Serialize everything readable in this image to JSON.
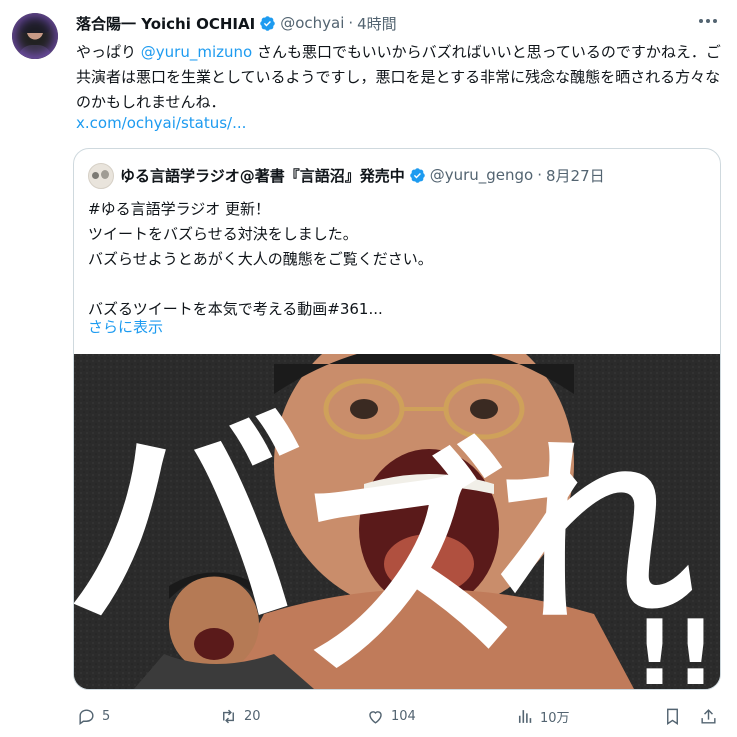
{
  "author": {
    "name": "落合陽一 Yoichi OCHIAI",
    "handle": "@ochyai",
    "separator": "·",
    "time": "4時間"
  },
  "tweet": {
    "text_before": "やっぱり ",
    "mention": "@yuru_mizuno",
    "text_after": " さんも悪口でもいいからバズればいいと思っているのですかねえ．ご共演者は悪口を生業としているようですし，悪口を是とする非常に残念な醜態を晒される方々なのかもしれませんね．",
    "link": "x.com/ochyai/status/..."
  },
  "quote": {
    "name": "ゆる言語学ラジオ@著書『言語沼』発売中",
    "handle": "@yuru_gengo",
    "separator": "·",
    "date": "8月27日",
    "text": "#ゆる言語学ラジオ 更新！\nツイートをバズらせる対決をしました。\nバズらせようとあがく大人の醜態をご覧ください。\n\nバズるツイートを本気で考える動画#361...",
    "show_more": "さらに表示",
    "media_text_1": "バ",
    "media_text_2": "ズ",
    "media_text_3": "れ",
    "media_text_4": "!!"
  },
  "actions": {
    "replies": "5",
    "retweets": "20",
    "likes": "104",
    "views": "10万"
  },
  "colors": {
    "link": "#1d9bf0",
    "secondary_text": "#536471",
    "border": "#cfd9de"
  }
}
